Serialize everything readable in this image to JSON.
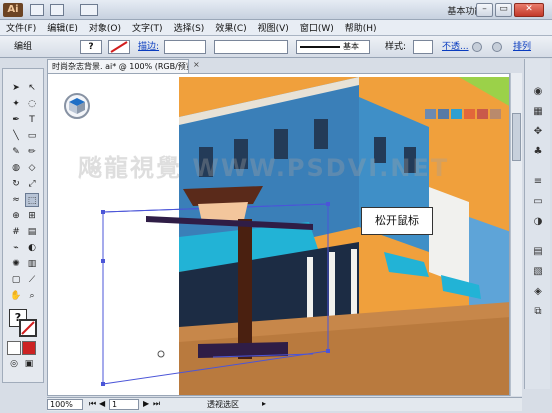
{
  "titlebar": {
    "logo": "Ai",
    "workspace": "基本功能",
    "minimize": "–",
    "restore": "▭",
    "close": "✕"
  },
  "menu": [
    "文件(F)",
    "编辑(E)",
    "对象(O)",
    "文字(T)",
    "选择(S)",
    "效果(C)",
    "视图(V)",
    "窗口(W)",
    "帮助(H)"
  ],
  "control": {
    "label": "编组",
    "question": "?",
    "stroke_label": "描边:",
    "basic": "基本",
    "style_label": "样式:",
    "opacity_link": "不透...",
    "arrange_link": "排列"
  },
  "document": {
    "tab_title": "时尚杂志背景. ai* @ 100% (RGB/预览)",
    "tab_close": "×"
  },
  "canvas": {
    "watermark": "飚龍視覺 WWW.PSDVI.NET",
    "tooltip": "松开鼠标"
  },
  "status": {
    "zoom": "100%",
    "page": "1",
    "mode": "透视选区"
  },
  "colors": {
    "accent": "#4b6fb3",
    "sky": "#f0a03c",
    "building": "#3a7fb8",
    "awning": "#22b3d6",
    "swatches": [
      "#6d8ab0",
      "#577aa6",
      "#2f9fd0",
      "#e2673a",
      "#c95a4a",
      "#b98a6c"
    ]
  },
  "icons": {
    "selection": "selection-arrow-icon",
    "direct": "direct-selection-icon",
    "pen": "pen-icon",
    "type": "type-icon",
    "line": "line-icon",
    "rect": "rectangle-icon",
    "brush": "brush-icon",
    "pencil": "pencil-icon",
    "eraser": "eraser-icon",
    "rotate": "rotate-icon",
    "scale": "scale-icon",
    "warp": "warp-icon",
    "free": "free-transform-icon",
    "shape": "shape-builder-icon",
    "perspective": "perspective-grid-icon",
    "mesh": "mesh-icon",
    "gradient": "gradient-icon",
    "eyedrop": "eyedropper-icon",
    "blend": "blend-icon",
    "symbol": "symbol-sprayer-icon",
    "graph": "graph-icon",
    "artboard": "artboard-icon",
    "slice": "slice-icon",
    "hand": "hand-icon",
    "zoom": "zoom-icon"
  }
}
